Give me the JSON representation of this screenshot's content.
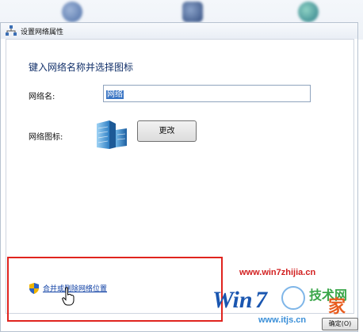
{
  "window": {
    "title": "设置网络属性"
  },
  "form": {
    "heading": "键入网络名称并选择图标",
    "name_label": "网络名:",
    "name_value": "网络",
    "icon_label": "网络图标:",
    "change_button": "更改"
  },
  "footer": {
    "merge_link": "合并或删除网络位置",
    "ok_button": "确定(O)"
  },
  "watermark": {
    "url_top": "www.win7zhijia.cn",
    "logo_text_win": "Win",
    "logo_text_7": "7",
    "logo_text_home": "家",
    "logo_text_cn": "技术网",
    "url_bottom": "www.itjs.cn"
  },
  "colors": {
    "highlight": "#e0241e",
    "link": "#0b3da3",
    "selection": "#3a75c4"
  }
}
